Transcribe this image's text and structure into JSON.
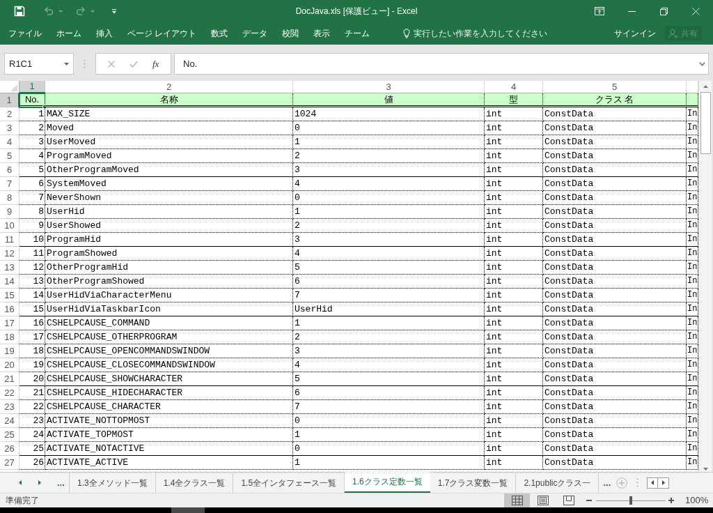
{
  "window": {
    "title": "DocJava.xls [保護ビュー] - Excel"
  },
  "ribbon": {
    "tabs": [
      "ファイル",
      "ホーム",
      "挿入",
      "ページ レイアウト",
      "数式",
      "データ",
      "校閲",
      "表示",
      "チーム"
    ],
    "tell_me": {
      "placeholder": "実行したい作業を入力してください"
    },
    "sign_in": "サインイン",
    "share": {
      "label": "共有",
      "disabled": true
    }
  },
  "formula_bar": {
    "name_box": "R1C1",
    "function_label": "fx",
    "value": "No."
  },
  "sheet": {
    "columns": [
      {
        "label": "1",
        "selected": true
      },
      {
        "label": "2",
        "selected": false
      },
      {
        "label": "3",
        "selected": false
      },
      {
        "label": "4",
        "selected": false
      },
      {
        "label": "5",
        "selected": false
      }
    ],
    "header_row": {
      "number": "1",
      "selected": true,
      "cells": [
        "No.",
        "名称",
        "値",
        "型",
        "クラス 名"
      ]
    },
    "rows": [
      {
        "number": "2",
        "selected": false,
        "group_end": false,
        "cells": [
          "1",
          "MAX_SIZE",
          "1024",
          "int",
          "ConstData",
          "In"
        ]
      },
      {
        "number": "3",
        "selected": false,
        "group_end": false,
        "cells": [
          "2",
          "Moved",
          "0",
          "int",
          "ConstData",
          "In"
        ]
      },
      {
        "number": "4",
        "selected": false,
        "group_end": false,
        "cells": [
          "3",
          "UserMoved",
          "1",
          "int",
          "ConstData",
          "In"
        ]
      },
      {
        "number": "5",
        "selected": false,
        "group_end": false,
        "cells": [
          "4",
          "ProgramMoved",
          "2",
          "int",
          "ConstData",
          "In"
        ]
      },
      {
        "number": "6",
        "selected": false,
        "group_end": true,
        "cells": [
          "5",
          "OtherProgramMoved",
          "3",
          "int",
          "ConstData",
          "In"
        ]
      },
      {
        "number": "7",
        "selected": false,
        "group_end": false,
        "cells": [
          "6",
          "SystemMoved",
          "4",
          "int",
          "ConstData",
          "In"
        ]
      },
      {
        "number": "8",
        "selected": false,
        "group_end": false,
        "cells": [
          "7",
          "NeverShown",
          "0",
          "int",
          "ConstData",
          "In"
        ]
      },
      {
        "number": "9",
        "selected": false,
        "group_end": false,
        "cells": [
          "8",
          "UserHid",
          "1",
          "int",
          "ConstData",
          "In"
        ]
      },
      {
        "number": "10",
        "selected": false,
        "group_end": false,
        "cells": [
          "9",
          "UserShowed",
          "2",
          "int",
          "ConstData",
          "In"
        ]
      },
      {
        "number": "11",
        "selected": false,
        "group_end": true,
        "cells": [
          "10",
          "ProgramHid",
          "3",
          "int",
          "ConstData",
          "In"
        ]
      },
      {
        "number": "12",
        "selected": false,
        "group_end": false,
        "cells": [
          "11",
          "ProgramShowed",
          "4",
          "int",
          "ConstData",
          "In"
        ]
      },
      {
        "number": "13",
        "selected": false,
        "group_end": false,
        "cells": [
          "12",
          "OtherProgramHid",
          "5",
          "int",
          "ConstData",
          "In"
        ]
      },
      {
        "number": "14",
        "selected": false,
        "group_end": false,
        "cells": [
          "13",
          "OtherProgramShowed",
          "6",
          "int",
          "ConstData",
          "In"
        ]
      },
      {
        "number": "15",
        "selected": false,
        "group_end": false,
        "cells": [
          "14",
          "UserHidViaCharacterMenu",
          "7",
          "int",
          "ConstData",
          "In"
        ]
      },
      {
        "number": "16",
        "selected": false,
        "group_end": true,
        "cells": [
          "15",
          "UserHidViaTaskbarIcon",
          "UserHid",
          "int",
          "ConstData",
          "In"
        ]
      },
      {
        "number": "17",
        "selected": false,
        "group_end": false,
        "cells": [
          "16",
          "CSHELPCAUSE_COMMAND",
          "1",
          "int",
          "ConstData",
          "In"
        ]
      },
      {
        "number": "18",
        "selected": false,
        "group_end": false,
        "cells": [
          "17",
          "CSHELPCAUSE_OTHERPROGRAM",
          "2",
          "int",
          "ConstData",
          "In"
        ]
      },
      {
        "number": "19",
        "selected": false,
        "group_end": false,
        "cells": [
          "18",
          "CSHELPCAUSE_OPENCOMMANDSWINDOW",
          "3",
          "int",
          "ConstData",
          "In"
        ]
      },
      {
        "number": "20",
        "selected": false,
        "group_end": false,
        "cells": [
          "19",
          "CSHELPCAUSE_CLOSECOMMANDSWINDOW",
          "4",
          "int",
          "ConstData",
          "In"
        ]
      },
      {
        "number": "21",
        "selected": false,
        "group_end": true,
        "cells": [
          "20",
          "CSHELPCAUSE_SHOWCHARACTER",
          "5",
          "int",
          "ConstData",
          "In"
        ]
      },
      {
        "number": "22",
        "selected": false,
        "group_end": false,
        "cells": [
          "21",
          "CSHELPCAUSE_HIDECHARACTER",
          "6",
          "int",
          "ConstData",
          "In"
        ]
      },
      {
        "number": "23",
        "selected": false,
        "group_end": false,
        "cells": [
          "22",
          "CSHELPCAUSE_CHARACTER",
          "7",
          "int",
          "ConstData",
          "In"
        ]
      },
      {
        "number": "24",
        "selected": false,
        "group_end": false,
        "cells": [
          "23",
          "ACTIVATE_NOTTOPMOST",
          "0",
          "int",
          "ConstData",
          "In"
        ]
      },
      {
        "number": "25",
        "selected": false,
        "group_end": false,
        "cells": [
          "24",
          "ACTIVATE_TOPMOST",
          "1",
          "int",
          "ConstData",
          "In"
        ]
      },
      {
        "number": "26",
        "selected": false,
        "group_end": true,
        "cells": [
          "25",
          "ACTIVATE_NOTACTIVE",
          "0",
          "int",
          "ConstData",
          "In"
        ]
      },
      {
        "number": "27",
        "selected": false,
        "group_end": false,
        "cells": [
          "26",
          "ACTIVATE_ACTIVE",
          "1",
          "int",
          "ConstData",
          "In"
        ]
      }
    ]
  },
  "sheet_tabs": {
    "more_left": "...",
    "tabs": [
      {
        "label": "1.3全メソッド一覧",
        "selected": false
      },
      {
        "label": "1.4全クラス一覧",
        "selected": false
      },
      {
        "label": "1.5全インタフェース一覧",
        "selected": false
      },
      {
        "label": "1.6クラス定数一覧",
        "selected": true
      },
      {
        "label": "1.7クラス変数一覧",
        "selected": false
      },
      {
        "label": "2.1publicクラス一",
        "selected": false
      }
    ],
    "more_right": "..."
  },
  "status_bar": {
    "status": "準備完了",
    "views": [
      {
        "kind": "normal",
        "selected": true
      },
      {
        "kind": "page_layout",
        "selected": false
      },
      {
        "kind": "page_break",
        "selected": false
      }
    ],
    "zoom": {
      "level": 0.5,
      "reading": "100%"
    }
  }
}
